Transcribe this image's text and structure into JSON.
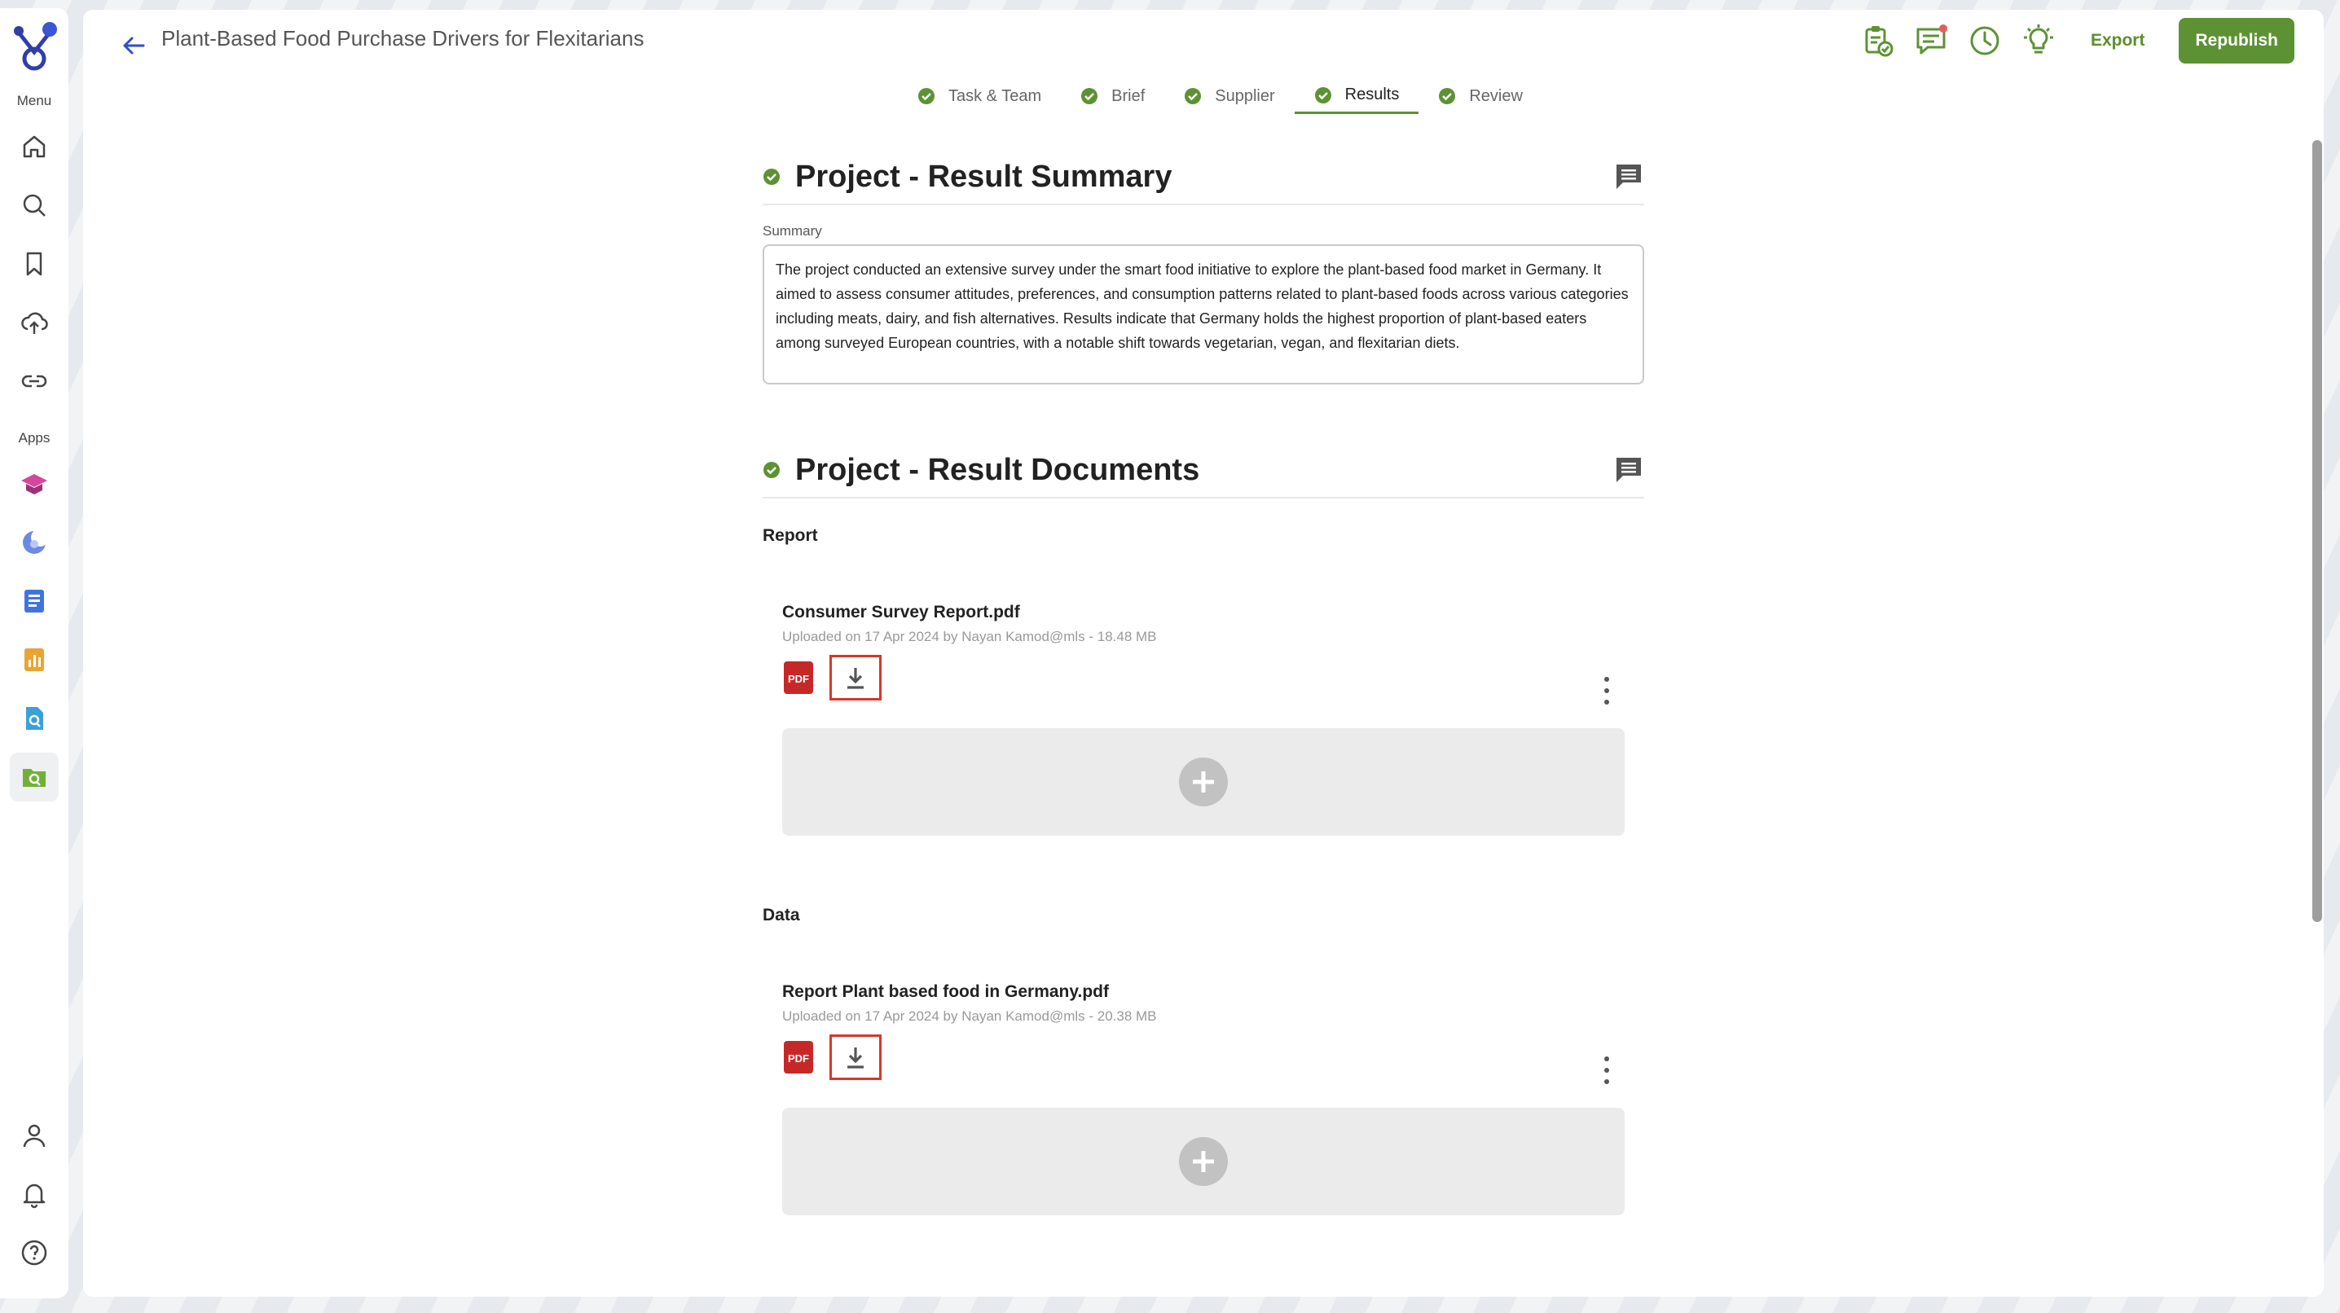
{
  "app": {
    "page_title": "Plant-Based Food Purchase Drivers for Flexitarians",
    "export_label": "Export",
    "republish_label": "Republish",
    "accent_color": "#5d9234"
  },
  "sidebar": {
    "menu_label": "Menu",
    "apps_label": "Apps",
    "menu_items": [
      "home-icon",
      "search-icon",
      "bookmark-icon",
      "upload-cloud-icon",
      "link-icon"
    ],
    "app_items": [
      "graduation-cap-app-icon",
      "moon-app-icon",
      "document-list-app-icon",
      "bar-chart-app-icon",
      "file-search-app-icon",
      "folder-search-app-icon"
    ],
    "bottom_items": [
      "user-icon",
      "bell-icon",
      "help-icon"
    ]
  },
  "stepper": {
    "steps": [
      {
        "label": "Task & Team",
        "active": false
      },
      {
        "label": "Brief",
        "active": false
      },
      {
        "label": "Supplier",
        "active": false
      },
      {
        "label": "Results",
        "active": true
      },
      {
        "label": "Review",
        "active": false
      }
    ]
  },
  "summary_section": {
    "title": "Project - Result Summary",
    "field_label": "Summary",
    "text": "The project conducted an extensive survey under the smart food initiative to explore the plant-based food market in Germany. It aimed to assess consumer attitudes, preferences, and consumption patterns related to plant-based foods across various categories including meats, dairy, and fish alternatives. Results indicate that Germany holds the highest proportion of plant-based eaters among surveyed European countries, with a notable shift towards vegetarian, vegan, and flexitarian diets."
  },
  "documents_section": {
    "title": "Project - Result Documents",
    "groups": [
      {
        "label": "Report",
        "file_name": "Consumer Survey Report.pdf",
        "meta": "Uploaded on 17 Apr 2024 by Nayan Kamod@mls - 18.48 MB",
        "file_type": "PDF"
      },
      {
        "label": "Data",
        "file_name": "Report Plant based food in Germany.pdf",
        "meta": "Uploaded on 17 Apr 2024 by Nayan Kamod@mls - 20.38 MB",
        "file_type": "PDF"
      }
    ]
  }
}
